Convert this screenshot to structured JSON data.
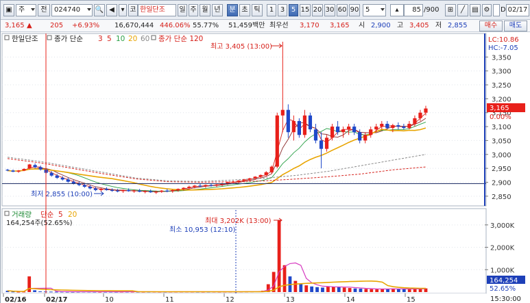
{
  "toolbar": {
    "period_select": "주",
    "prev_label": "전",
    "stock_code": "024740",
    "code_prefix": "코",
    "stock_name": "한일단조",
    "period_tabs": [
      "일",
      "주",
      "월",
      "년",
      "분",
      "초",
      "틱"
    ],
    "active_period": "분",
    "interval_buttons": [
      "1",
      "3",
      "5",
      "15",
      "20",
      "30",
      "60",
      "90"
    ],
    "active_interval": "5",
    "interval_select": "5",
    "count_value": "85",
    "count_total": "/900",
    "date_value": "02/17"
  },
  "infobar": {
    "price": "3,165",
    "change": "205",
    "change_pct": "+6.93%",
    "volume": "16,670,444",
    "volume_ratio": "446.06%",
    "volume_share": "55.77%",
    "trade_amount": "51,459백만",
    "best_bid_label": "최우선",
    "ask_price": "3,170",
    "bid_price": "3,165",
    "open_label": "시",
    "open": "2,900",
    "high_label": "고",
    "high": "3,405",
    "low_label": "저",
    "low": "2,855",
    "buy_label": "매수",
    "sell_label": "매도"
  },
  "price_panel": {
    "legend_name": "한일단조",
    "ma_label": "종가 단순",
    "ma_periods": [
      "3",
      "5",
      "10",
      "20",
      "60"
    ],
    "ma_long_label": "종가 단순 120",
    "lc_label": "LC:10.86",
    "hc_label": "HC:-7.05",
    "high_annotation": "최고 3,405 (13:00)",
    "low_annotation": "최저 2,855 (10:00)",
    "current_price_tag": "3,165",
    "current_pct_tag": "0.00%"
  },
  "volume_panel": {
    "legend_name": "거래량",
    "ma_label": "단순",
    "ma_periods": [
      "5",
      "20"
    ],
    "current_volume": "164,254주(52.65%)",
    "max_annotation": "최대 3,202K (13:00)",
    "min_annotation": "최소 10,953 (12:10)",
    "current_tag": "164,254",
    "current_pct_tag": "52.65%"
  },
  "time_axis": {
    "labels": [
      "02/16",
      "02/17",
      "10",
      "11",
      "12",
      "13",
      "14",
      "15"
    ],
    "cursor_time": "15:30:00"
  },
  "colors": {
    "up": "#e8201a",
    "down": "#1f48c9",
    "ma3": "#d6201a",
    "ma5": "#d6201a",
    "ma10": "#2aa046",
    "ma20": "#e8a400",
    "ma60": "#888888",
    "ma120": "#d6201a"
  },
  "chart_data": {
    "type": "candlestick",
    "y_axis_ticks": [
      "3,350",
      "3,300",
      "3,250",
      "3,200",
      "3,150",
      "3,100",
      "3,050",
      "3,000",
      "2,950",
      "2,900",
      "2,850"
    ],
    "y_range": [
      2825,
      3400
    ],
    "volume_axis_ticks": [
      "3,000K",
      "2,000K",
      "1,000K"
    ],
    "volume_range": [
      0,
      3300
    ],
    "candles": [
      [
        2945,
        2948,
        2940,
        2942
      ],
      [
        2942,
        2946,
        2936,
        2938
      ],
      [
        2938,
        2944,
        2934,
        2942
      ],
      [
        2942,
        2950,
        2940,
        2948
      ],
      [
        2950,
        2966,
        2946,
        2964
      ],
      [
        2962,
        2968,
        2950,
        2954
      ],
      [
        2954,
        2960,
        2942,
        2946
      ],
      [
        2946,
        2950,
        2930,
        2934
      ],
      [
        2934,
        2940,
        2920,
        2924
      ],
      [
        2924,
        2930,
        2912,
        2916
      ],
      [
        2916,
        2922,
        2906,
        2910
      ],
      [
        2910,
        2916,
        2898,
        2902
      ],
      [
        2902,
        2908,
        2892,
        2896
      ],
      [
        2896,
        2902,
        2886,
        2890
      ],
      [
        2890,
        2895,
        2880,
        2884
      ],
      [
        2884,
        2890,
        2874,
        2878
      ],
      [
        2878,
        2884,
        2868,
        2872
      ],
      [
        2872,
        2880,
        2866,
        2876
      ],
      [
        2876,
        2882,
        2870,
        2872
      ],
      [
        2872,
        2878,
        2866,
        2870
      ],
      [
        2870,
        2876,
        2864,
        2868
      ],
      [
        2868,
        2874,
        2862,
        2872
      ],
      [
        2872,
        2878,
        2866,
        2868
      ],
      [
        2868,
        2874,
        2862,
        2870
      ],
      [
        2870,
        2876,
        2864,
        2866
      ],
      [
        2866,
        2872,
        2860,
        2868
      ],
      [
        2868,
        2874,
        2862,
        2864
      ],
      [
        2864,
        2870,
        2858,
        2866
      ],
      [
        2866,
        2872,
        2862,
        2870
      ],
      [
        2870,
        2876,
        2864,
        2868
      ],
      [
        2868,
        2874,
        2862,
        2872
      ],
      [
        2872,
        2878,
        2866,
        2876
      ],
      [
        2876,
        2882,
        2870,
        2880
      ],
      [
        2880,
        2888,
        2874,
        2884
      ],
      [
        2884,
        2890,
        2878,
        2888
      ],
      [
        2888,
        2894,
        2882,
        2886
      ],
      [
        2886,
        2892,
        2880,
        2890
      ],
      [
        2890,
        2896,
        2884,
        2888
      ],
      [
        2888,
        2894,
        2882,
        2892
      ],
      [
        2892,
        2898,
        2886,
        2896
      ],
      [
        2896,
        2902,
        2890,
        2900
      ],
      [
        2900,
        2906,
        2894,
        2902
      ],
      [
        2902,
        2908,
        2896,
        2906
      ],
      [
        2906,
        2912,
        2900,
        2910
      ],
      [
        2910,
        2916,
        2904,
        2914
      ],
      [
        2914,
        2922,
        2908,
        2920
      ],
      [
        2920,
        2928,
        2914,
        2926
      ],
      [
        2926,
        2940,
        2920,
        2936
      ],
      [
        2936,
        2960,
        2930,
        2956
      ],
      [
        2956,
        3150,
        2950,
        3140
      ],
      [
        3140,
        3405,
        3080,
        3160
      ],
      [
        3160,
        3180,
        3060,
        3080
      ],
      [
        3080,
        3140,
        3050,
        3120
      ],
      [
        3120,
        3130,
        3060,
        3070
      ],
      [
        3070,
        3160,
        3060,
        3140
      ],
      [
        3140,
        3150,
        3080,
        3090
      ],
      [
        3090,
        3110,
        3040,
        3050
      ],
      [
        3050,
        3080,
        2950,
        3020
      ],
      [
        3020,
        3070,
        3010,
        3060
      ],
      [
        3060,
        3110,
        3050,
        3100
      ],
      [
        3100,
        3120,
        3070,
        3080
      ],
      [
        3080,
        3100,
        3060,
        3090
      ],
      [
        3090,
        3110,
        3070,
        3100
      ],
      [
        3100,
        3110,
        3070,
        3080
      ],
      [
        3080,
        3090,
        3040,
        3050
      ],
      [
        3050,
        3080,
        3040,
        3070
      ],
      [
        3070,
        3100,
        3060,
        3090
      ],
      [
        3090,
        3110,
        3080,
        3100
      ],
      [
        3100,
        3120,
        3090,
        3110
      ],
      [
        3110,
        3120,
        3090,
        3095
      ],
      [
        3095,
        3110,
        3080,
        3105
      ],
      [
        3105,
        3115,
        3090,
        3100
      ],
      [
        3100,
        3110,
        3090,
        3095
      ],
      [
        3095,
        3120,
        3090,
        3110
      ],
      [
        3110,
        3140,
        3100,
        3130
      ],
      [
        3130,
        3160,
        3120,
        3150
      ],
      [
        3150,
        3175,
        3140,
        3165
      ]
    ],
    "volumes": [
      60,
      20,
      15,
      18,
      700,
      80,
      30,
      25,
      20,
      15,
      18,
      15,
      12,
      15,
      20,
      18,
      15,
      12,
      14,
      15,
      12,
      14,
      16,
      15,
      13,
      12,
      14,
      15,
      13,
      12,
      14,
      15,
      16,
      18,
      15,
      14,
      13,
      15,
      16,
      14,
      15,
      18,
      16,
      20,
      22,
      25,
      30,
      60,
      350,
      900,
      3202,
      1200,
      700,
      500,
      350,
      300,
      250,
      220,
      200,
      260,
      240,
      220,
      200,
      180,
      160,
      150,
      140,
      130,
      120,
      140,
      150,
      160,
      140,
      130,
      120,
      150,
      170,
      164
    ]
  }
}
